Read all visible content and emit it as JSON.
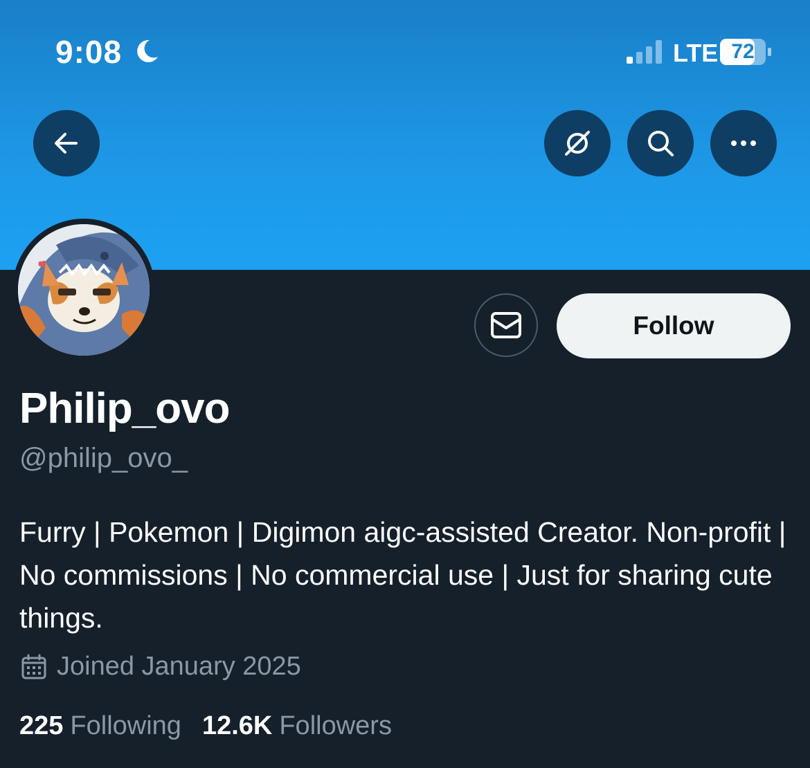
{
  "status_bar": {
    "time": "9:08",
    "network": "LTE",
    "battery": "72"
  },
  "icons": {
    "back": "arrow-left-icon",
    "grok": "grok-icon",
    "search": "search-icon",
    "more": "more-horizontal-icon",
    "message": "envelope-icon",
    "calendar": "calendar-icon",
    "moon": "moon-icon"
  },
  "profile": {
    "display_name": "Philip_ovo",
    "handle": "@philip_ovo_",
    "bio": "Furry | Pokemon | Digimon aigc-assisted Creator. Non-profit | No commissions | No commercial use | Just for sharing cute things.",
    "joined": "Joined January 2025",
    "following_count": "225",
    "following_label": "Following",
    "followers_count": "12.6K",
    "followers_label": "Followers"
  },
  "actions": {
    "follow_label": "Follow"
  },
  "colors": {
    "banner_top": "#1a7fc9",
    "banner_bottom": "#1da1f2",
    "background": "#15202b",
    "muted_text": "#8b98a5",
    "follow_bg": "#eff3f4"
  }
}
